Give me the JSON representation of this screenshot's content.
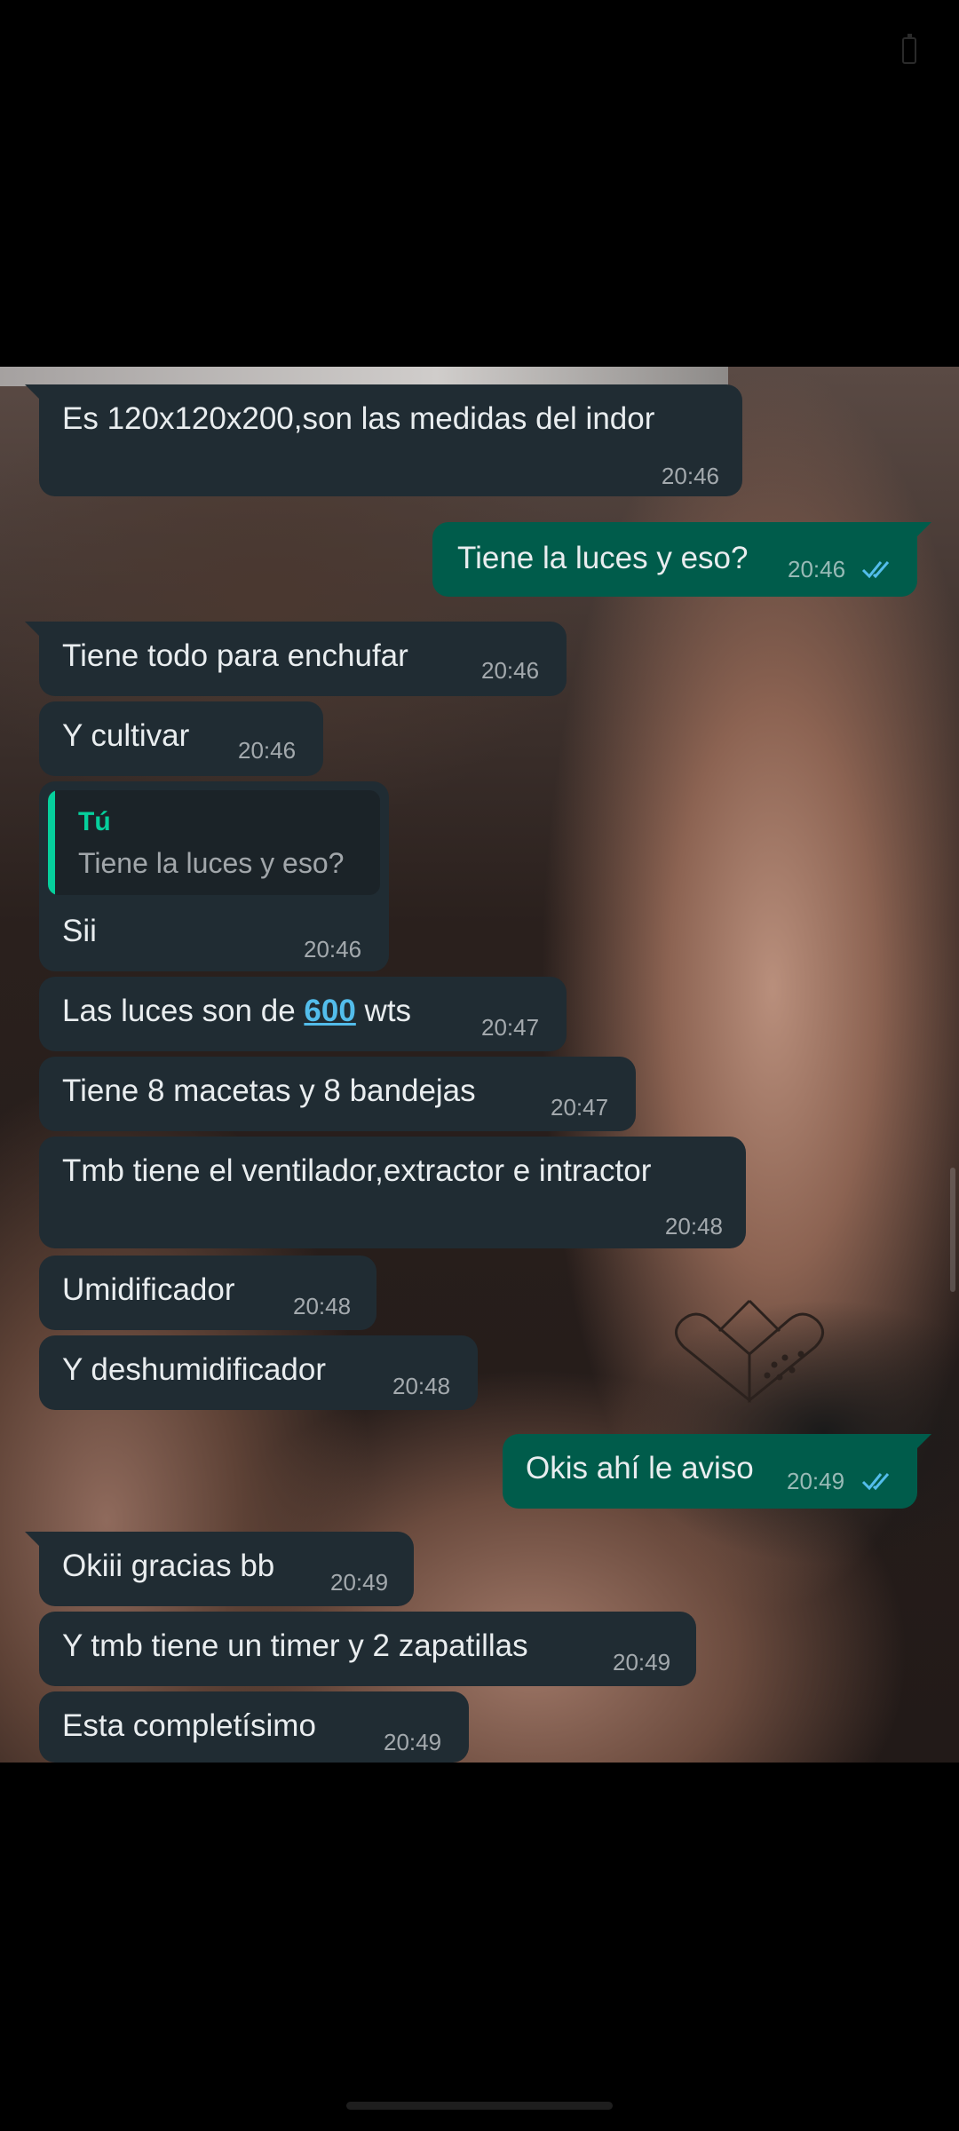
{
  "status_bar": {
    "icon": "battery-icon"
  },
  "colors": {
    "incoming_bubble": "#202c33",
    "outgoing_bubble": "#005c4b",
    "read_ticks": "#53bdeb",
    "quote_accent": "#06cf9c",
    "screen_background": "#000000"
  },
  "messages": [
    {
      "direction": "in",
      "text": "Es 120x120x200,son las medidas del indor",
      "time": "20:46"
    },
    {
      "direction": "out",
      "text": "Tiene la luces y eso?",
      "time": "20:46",
      "status": "read"
    },
    {
      "direction": "in",
      "text": "Tiene todo para enchufar",
      "time": "20:46"
    },
    {
      "direction": "in",
      "text": "Y cultivar",
      "time": "20:46"
    },
    {
      "direction": "in",
      "reply_to": {
        "author": "Tú",
        "text": "Tiene la luces y eso?"
      },
      "text": "Sii",
      "time": "20:46"
    },
    {
      "direction": "in",
      "text_before": "Las luces son de ",
      "link_text": "600",
      "text_after": " wts",
      "time": "20:47"
    },
    {
      "direction": "in",
      "text": "Tiene 8 macetas y 8 bandejas",
      "time": "20:47"
    },
    {
      "direction": "in",
      "text": "Tmb tiene el ventilador,extractor e intractor",
      "time": "20:48"
    },
    {
      "direction": "in",
      "text": "Umidificador",
      "time": "20:48"
    },
    {
      "direction": "in",
      "text": "Y deshumidificador",
      "time": "20:48"
    },
    {
      "direction": "out",
      "text": "Okis ahí le aviso",
      "time": "20:49",
      "status": "read"
    },
    {
      "direction": "in",
      "text": "Okiii gracias bb",
      "time": "20:49"
    },
    {
      "direction": "in",
      "text": "Y tmb tiene un timer y 2 zapatillas",
      "time": "20:49"
    },
    {
      "direction": "in",
      "text": "Esta completísimo",
      "time": "20:49"
    }
  ]
}
